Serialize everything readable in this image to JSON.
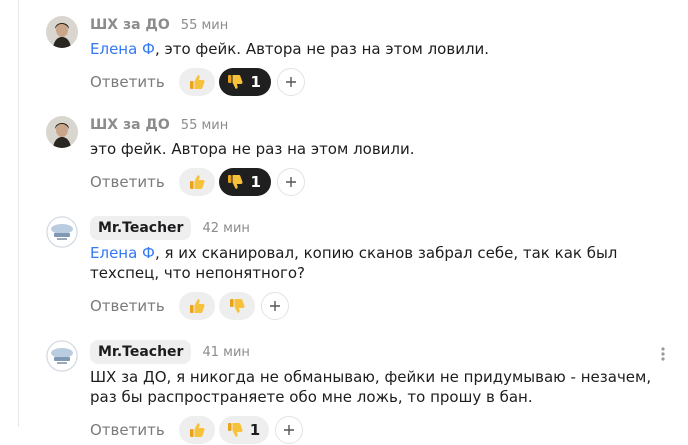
{
  "comments": [
    {
      "author": "ШХ за ДО",
      "time": "55 мин",
      "mention": "Елена Ф",
      "text": ", это фейк. Автора не раз на этом ловили.",
      "reply_label": "Ответить",
      "dislike_count": "1",
      "avatar_icon": "sherlock-avatar"
    },
    {
      "author": "ШХ за ДО",
      "time": "55 мин",
      "text": "это фейк. Автора не раз на этом ловили.",
      "reply_label": "Ответить",
      "dislike_count": "1",
      "avatar_icon": "sherlock-avatar"
    },
    {
      "author": "Mr.Teacher",
      "time": "42 мин",
      "mention": "Елена Ф",
      "text": ", я их сканировал, копию сканов забрал себе, так как был техспец, что непонятного?",
      "reply_label": "Ответить",
      "avatar_icon": "teacher-avatar"
    },
    {
      "author": "Mr.Teacher",
      "time": "41 мин",
      "text": "ШХ за ДО, я никогда не обманываю, фейки не придумываю - незачем, раз бы распространяете обо мне ложь, то прошу в бан.",
      "reply_label": "Ответить",
      "dislike_count": "1",
      "avatar_icon": "teacher-avatar"
    }
  ],
  "colors": {
    "mention": "#3478f6",
    "active_reaction": "#1f1f1f",
    "reaction_bg": "#eeeeee"
  }
}
